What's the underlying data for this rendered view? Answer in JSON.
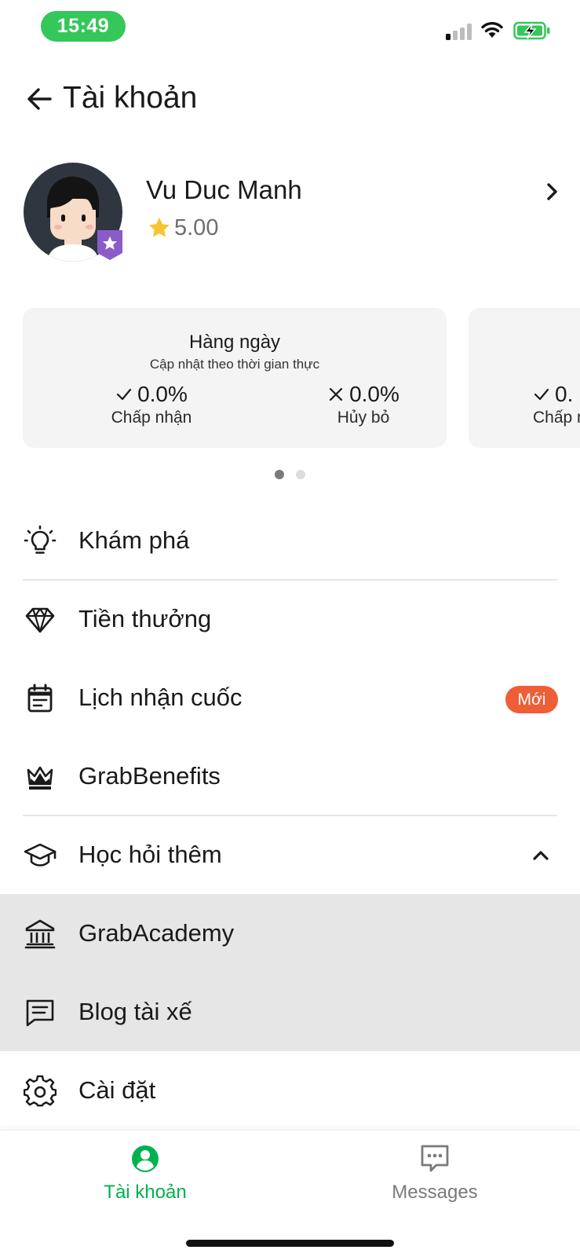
{
  "status_bar": {
    "time": "15:49",
    "colors": {
      "time_pill": "#34c759",
      "battery": "#34c759"
    },
    "icons": [
      "cellular-signal-icon",
      "wifi-icon",
      "battery-charging-icon"
    ]
  },
  "header": {
    "title": "Tài khoản",
    "back_icon": "arrow-left-icon"
  },
  "profile": {
    "name": "Vu Duc Manh",
    "rating": "5.00",
    "rating_icon": "star-icon",
    "badge_icon": "star-shield-icon",
    "chevron_icon": "chevron-right-icon"
  },
  "stats": {
    "cards": [
      {
        "title": "Hàng ngày",
        "subtitle": "Cập nhật theo thời gian thực",
        "accept": {
          "value": "0.0%",
          "label": "Chấp nhận",
          "icon": "check-icon"
        },
        "cancel": {
          "value": "0.0%",
          "label": "Hủy bỏ",
          "icon": "x-icon"
        }
      },
      {
        "accept": {
          "value": "0.",
          "label": "Chấp n",
          "icon": "check-icon"
        }
      }
    ],
    "active_page": 1,
    "page_count": 2
  },
  "menu": {
    "items": [
      {
        "label": "Khám phá",
        "icon": "lightbulb-icon"
      },
      {
        "label": "Tiền thưởng",
        "icon": "diamond-icon"
      },
      {
        "label": "Lịch nhận cuốc",
        "icon": "calendar-icon",
        "badge": "Mới"
      },
      {
        "label": "GrabBenefits",
        "icon": "crown-icon"
      },
      {
        "label": "Học hỏi thêm",
        "icon": "graduation-cap-icon",
        "expanded": true
      },
      {
        "label": "GrabAcademy",
        "icon": "academy-building-icon"
      },
      {
        "label": "Blog tài xế",
        "icon": "message-lines-icon"
      },
      {
        "label": "Cài đặt",
        "icon": "gear-icon"
      }
    ],
    "colors": {
      "badge": "#ee5f38",
      "submenu_bg": "#e6e6e6"
    }
  },
  "bottom_nav": {
    "tabs": [
      {
        "label": "Tài khoản",
        "icon": "account-icon",
        "active": true
      },
      {
        "label": "Messages",
        "icon": "chat-bubble-icon",
        "active": false
      }
    ],
    "colors": {
      "active": "#00b14f",
      "inactive": "#7a7a7a"
    }
  }
}
